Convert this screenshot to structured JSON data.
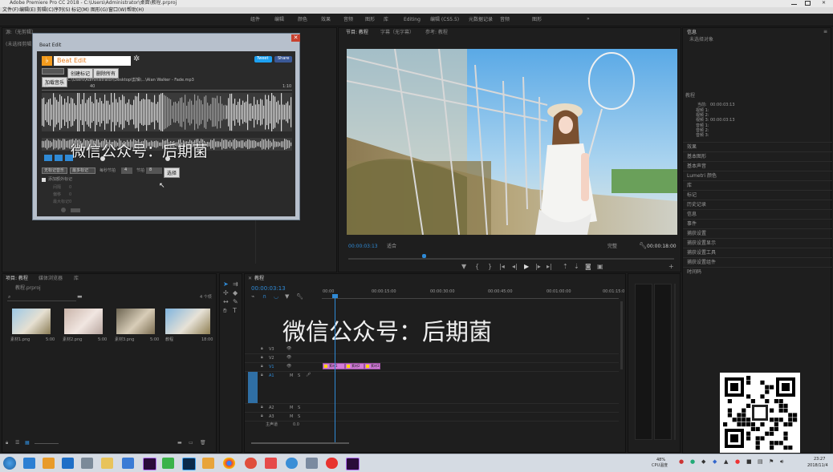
{
  "app": {
    "title": "Adobe Premiere Pro CC 2018 - C:\\Users\\Administrator\\桌面\\教程.prproj",
    "menu": [
      "文件(F)",
      "编辑(E)",
      "剪辑(C)",
      "序列(S)",
      "标记(M)",
      "图形(G)",
      "窗口(W)",
      "帮助(H)"
    ],
    "workspaces": [
      "组件",
      "编辑",
      "颜色",
      "效果",
      "音频",
      "图形",
      "库",
      "Editing",
      "编辑 (CS5.5)",
      "元数据记录",
      "音频",
      "图形"
    ]
  },
  "source_panel": {
    "tabs": [
      "源:（无剪辑）",
      "效果控件",
      "音频剪辑混合器",
      "元数据"
    ],
    "sub": "(未选择剪辑)"
  },
  "beat_edit": {
    "window_title": "Beat Edit",
    "app_name": "Beat Edit",
    "tweet_label": "Tweet",
    "share_label": "Share",
    "buttons": [
      "创建标记",
      "删除所有"
    ],
    "load_label": "加载音乐",
    "file_path": "C:\\Users\\Administrator\\Desktop\\剪辑\\...\\Alan Walker - Fade.mp3",
    "ruler_start": "00",
    "ruler_mid": "40",
    "ruler_end": "1:10",
    "watermark": "微信公众号：后期菌",
    "select_left": "无标记音乐",
    "select_mid": "最多标记",
    "field_label": "每秒节拍",
    "field_value": "4",
    "field_label2": "节拍",
    "field_value2": "8",
    "apply_label": "选择",
    "checkbox_label": "添加额外标记",
    "rows": [
      {
        "label": "间隔",
        "value": "0"
      },
      {
        "label": "偏移",
        "value": "0"
      },
      {
        "label": "最大标记",
        "value": "0"
      }
    ]
  },
  "program_panel": {
    "tabs": [
      "节目: 教程",
      "字幕（无字幕）",
      "参考: 教程"
    ],
    "timecode": "00:00:03:13",
    "fit": "适合",
    "scale": "完整",
    "duration": "00:00:18:00"
  },
  "right_panel": {
    "header": "信息",
    "sub": "未选择对象",
    "section": "教程",
    "info_rows": [
      {
        "label": "当前:",
        "value": "00:00:03:13"
      },
      {
        "label": "视频 1:",
        "value": ""
      },
      {
        "label": "视频 2:",
        "value": ""
      },
      {
        "label": "视频 3:",
        "value": "00:00:03:13"
      },
      {
        "label": "音频 1:",
        "value": ""
      },
      {
        "label": "音频 2:",
        "value": ""
      },
      {
        "label": "音频 3:",
        "value": ""
      }
    ],
    "panels": [
      "效果",
      "基本图形",
      "基本声音",
      "Lumetri 颜色",
      "库",
      "标记",
      "历史记录",
      "信息",
      "事件",
      "捕获设置",
      "捕获设置显示",
      "捕获设置工具",
      "捕获设置组件",
      "时间码"
    ]
  },
  "project_panel": {
    "tabs": [
      "项目: 教程",
      "媒体浏览器",
      "库"
    ],
    "project_file": "教程.prproj",
    "count": "4 个项",
    "items": [
      {
        "name": "素材1.png",
        "duration": "5:00"
      },
      {
        "name": "素材2.png",
        "duration": "5:00"
      },
      {
        "name": "素材3.png",
        "duration": "5:00"
      },
      {
        "name": "教程",
        "duration": "18:00"
      }
    ]
  },
  "timeline": {
    "tab": "教程",
    "timecode": "00:00:03:13",
    "ruler": [
      "00:00",
      "00:00:15:00",
      "00:00:30:00",
      "00:00:45:00",
      "00:01:00:00",
      "00:01:15:0"
    ],
    "video_tracks": [
      "V3",
      "V2",
      "V1"
    ],
    "audio_tracks": [
      "A1",
      "A2",
      "A3"
    ],
    "master": "主声道",
    "master_value": "0.0",
    "clips": [
      "素材1",
      "素材2",
      "素材3"
    ],
    "watermark": "微信公众号：后期菌"
  },
  "taskbar": {
    "clock_time": "23:27",
    "clock_date": "2018/11/4",
    "weather": "48%",
    "weather_sub": "CPU温度"
  },
  "colors": {
    "accent": "#2f8ad6",
    "clip": "#d27bd8",
    "marker": "#ffd400"
  }
}
